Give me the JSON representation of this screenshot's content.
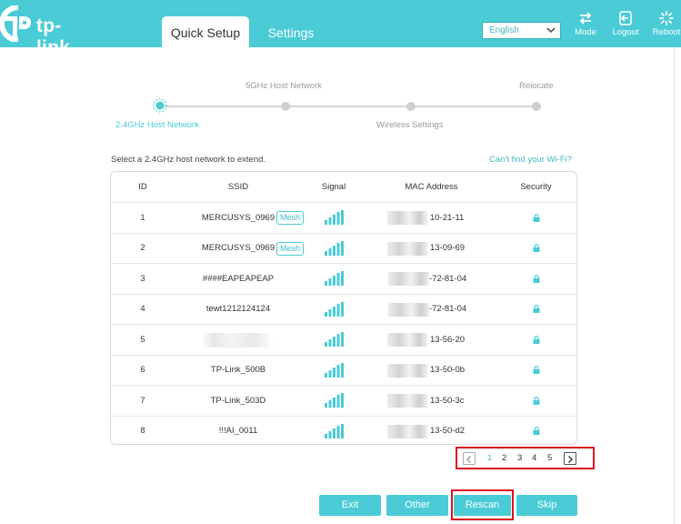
{
  "header": {
    "brand": "tp-link",
    "tabs": [
      {
        "label": "Quick Setup",
        "active": true
      },
      {
        "label": "Settings",
        "active": false
      }
    ],
    "language": {
      "selected": "English"
    },
    "buttons": [
      {
        "label": "Mode",
        "icon": "mode-icon"
      },
      {
        "label": "Logout",
        "icon": "logout-icon"
      },
      {
        "label": "Reboot",
        "icon": "reboot-icon"
      }
    ]
  },
  "progress": {
    "steps": [
      {
        "label": "2.4GHz Host Network",
        "active": true
      },
      {
        "label": "5GHz Host Network",
        "active": false
      },
      {
        "label": "Wireless Settings",
        "active": false
      },
      {
        "label": "Relocate",
        "active": false
      }
    ]
  },
  "main": {
    "intro": "Select a 2.4GHz host network to extend.",
    "help_link": "Can't find your Wi-Fi?",
    "columns": [
      "ID",
      "SSID",
      "Signal",
      "MAC Address",
      "Security"
    ],
    "rows": [
      {
        "id": "1",
        "ssid": "MERCUSYS_0969",
        "mesh": "Mesh",
        "mac": "10-21-11"
      },
      {
        "id": "2",
        "ssid": "MERCUSYS_0969",
        "mesh": "Mesh",
        "mac": "13-09-69"
      },
      {
        "id": "3",
        "ssid": "####EAPEAPEAP",
        "mesh": "",
        "mac": "-72-81-04"
      },
      {
        "id": "4",
        "ssid": "tewt1212124124",
        "mesh": "",
        "mac": "-72-81-04"
      },
      {
        "id": "5",
        "ssid": "",
        "mesh": "",
        "mac": "13-56-20"
      },
      {
        "id": "6",
        "ssid": "TP-Link_500B",
        "mesh": "",
        "mac": "13-50-0b"
      },
      {
        "id": "7",
        "ssid": "TP-Link_503D",
        "mesh": "",
        "mac": "13-50-3c"
      },
      {
        "id": "8",
        "ssid": "!!!AI_0011",
        "mesh": "",
        "mac": "13-50-d2"
      }
    ]
  },
  "pagination": {
    "pages": [
      "1",
      "2",
      "3",
      "4",
      "5"
    ],
    "current": "1"
  },
  "actions": {
    "exit": "Exit",
    "other": "Other",
    "rescan": "Rescan",
    "skip": "Skip"
  },
  "colors": {
    "brand": "#4acbd6",
    "highlight": "#d9141f"
  }
}
